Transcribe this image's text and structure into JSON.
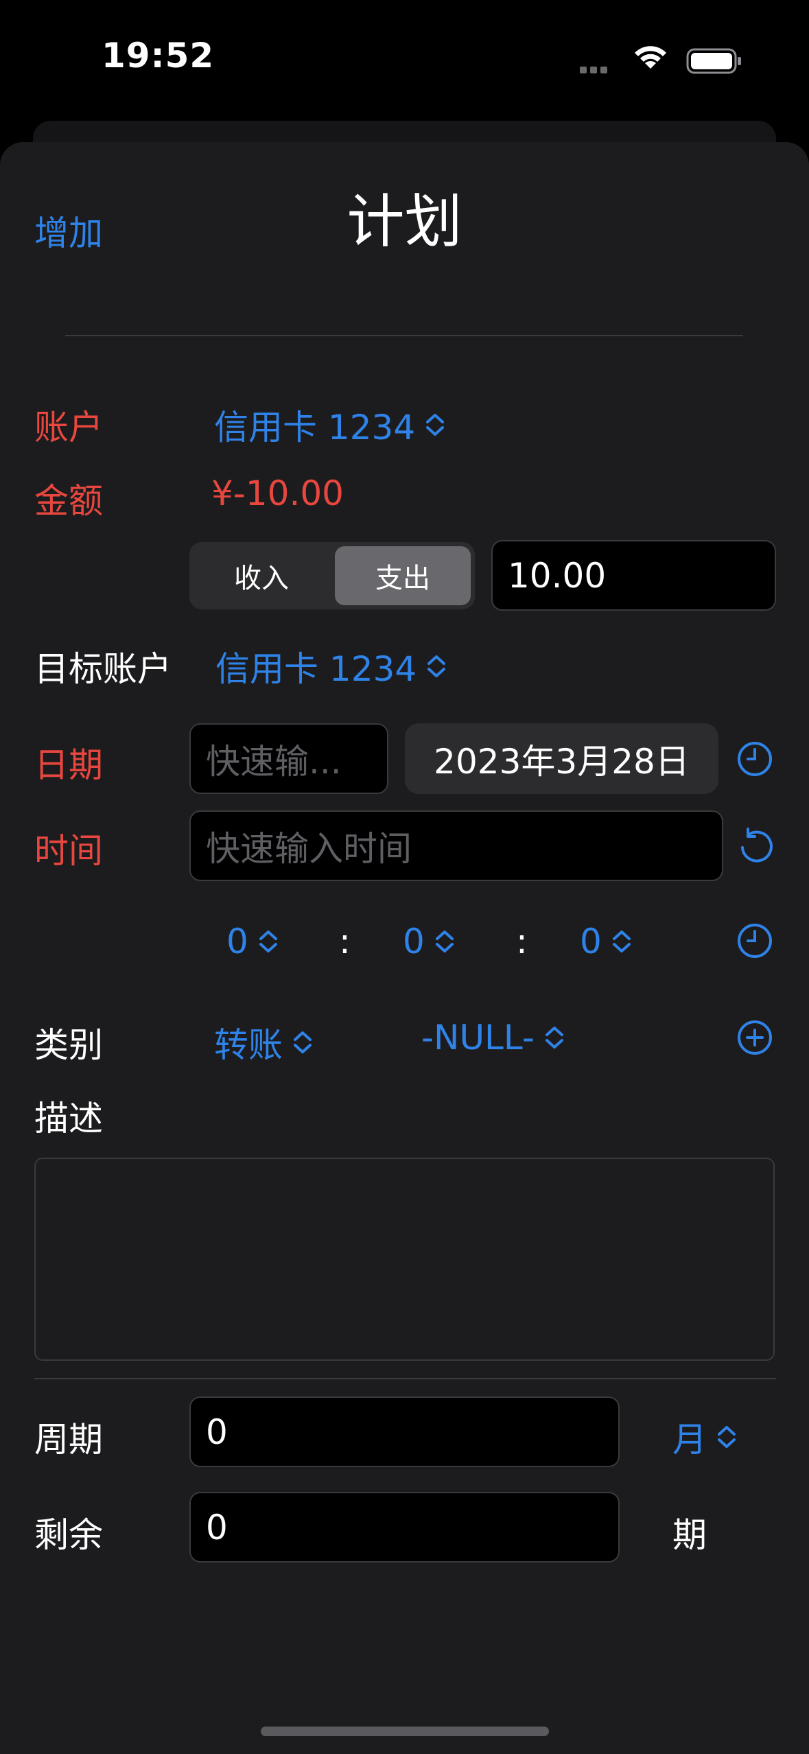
{
  "status": {
    "time": "19:52"
  },
  "nav": {
    "add_label": "增加",
    "title": "计划"
  },
  "account": {
    "label": "账户",
    "value": "信用卡 1234"
  },
  "amount": {
    "label": "金额",
    "value": "¥-10.00"
  },
  "direction": {
    "income": "收入",
    "expense": "支出",
    "selected": "支出",
    "amount_input": "10.00"
  },
  "target_account": {
    "label": "目标账户",
    "value": "信用卡 1234"
  },
  "date": {
    "label": "日期",
    "quick_placeholder": "快速输...",
    "value": "2023年3月28日"
  },
  "time_row": {
    "label": "时间",
    "quick_placeholder": "快速输入时间"
  },
  "time_pickers": {
    "hour": "0",
    "minute": "0",
    "second": "0",
    "separator": ":"
  },
  "category": {
    "label": "类别",
    "main": "转账",
    "sub": "-NULL-"
  },
  "description": {
    "label": "描述",
    "value": ""
  },
  "period": {
    "label": "周期",
    "value": "0",
    "unit": "月"
  },
  "remaining": {
    "label": "剩余",
    "value": "0",
    "unit": "期"
  },
  "colors": {
    "accent": "#2f83e8",
    "required": "#e8473f",
    "sheet": "#1c1c1e",
    "field": "#000000"
  }
}
